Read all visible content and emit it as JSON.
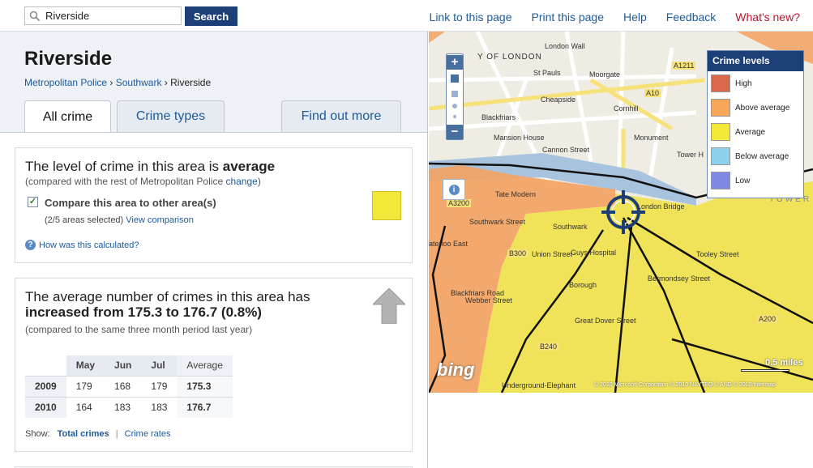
{
  "search": {
    "value": "Riverside",
    "button": "Search"
  },
  "toplinks": [
    "Link to this page",
    "Print this page",
    "Help",
    "Feedback",
    "What's new?"
  ],
  "area": {
    "title": "Riverside",
    "breadcrumb": [
      "Metropolitan Police",
      "Southwark",
      "Riverside"
    ],
    "breadcrumb_sep": "›"
  },
  "tabs": [
    "All crime",
    "Crime types",
    "Find out more"
  ],
  "level": {
    "prefix": "The level of crime in this area is ",
    "value": "average",
    "compared": "(compared with the rest of Metropolitan Police ",
    "change_link": "change",
    "compared_end": ")",
    "compare_label": "Compare this area to other area(s)",
    "selected": "(2/5 areas selected)",
    "view_link": "View comparison",
    "how_link": "How was this calculated?",
    "swatch_color": "#f3e737"
  },
  "trend": {
    "line1": "The average number of crimes in this area has",
    "line2": "increased from 175.3 to 176.7 (0.8%)",
    "note": "(compared to the same three month period last year)",
    "columns": [
      "May",
      "Jun",
      "Jul",
      "Average"
    ],
    "rows": [
      {
        "year": "2009",
        "values": [
          "179",
          "168",
          "179"
        ],
        "average": "175.3"
      },
      {
        "year": "2010",
        "values": [
          "164",
          "183",
          "183"
        ],
        "average": "176.7"
      }
    ],
    "show_label": "Show:",
    "show_total": "Total crimes",
    "show_rates": "Crime rates"
  },
  "legend": {
    "title": "Crime levels",
    "items": [
      {
        "label": "High",
        "color": "#d9674a"
      },
      {
        "label": "Above average",
        "color": "#f9a55a"
      },
      {
        "label": "Average",
        "color": "#f3e737"
      },
      {
        "label": "Below average",
        "color": "#8fd0ec"
      },
      {
        "label": "Low",
        "color": "#8088e6"
      }
    ]
  },
  "map": {
    "labels": [
      "Y OF LONDON",
      "London Wall",
      "St Pauls",
      "Cheapside",
      "Moorgate",
      "Cornhill",
      "Blackfriars",
      "Mansion House",
      "Cannon Street",
      "Monument",
      "London Bridge",
      "Tower H",
      "Tate Modern",
      "Southwark Street",
      "Southwark",
      "Guys Hospital",
      "Borough",
      "Webber Street",
      "Great Dover Street",
      "Union Street",
      "Tooley Street",
      "aterloo East",
      "Blackfriars Road",
      "Bermondsey Street",
      "Underground-Elephant",
      "A1211",
      "A10",
      "A3200",
      "B300",
      "B240",
      "A200",
      "TOWER"
    ],
    "scale": "0.5 miles",
    "brand": "bing",
    "copyright": "© 2010 Microsoft Corporation   © 2010 NAVTEQ   © AND   © 2010 Intermap"
  }
}
